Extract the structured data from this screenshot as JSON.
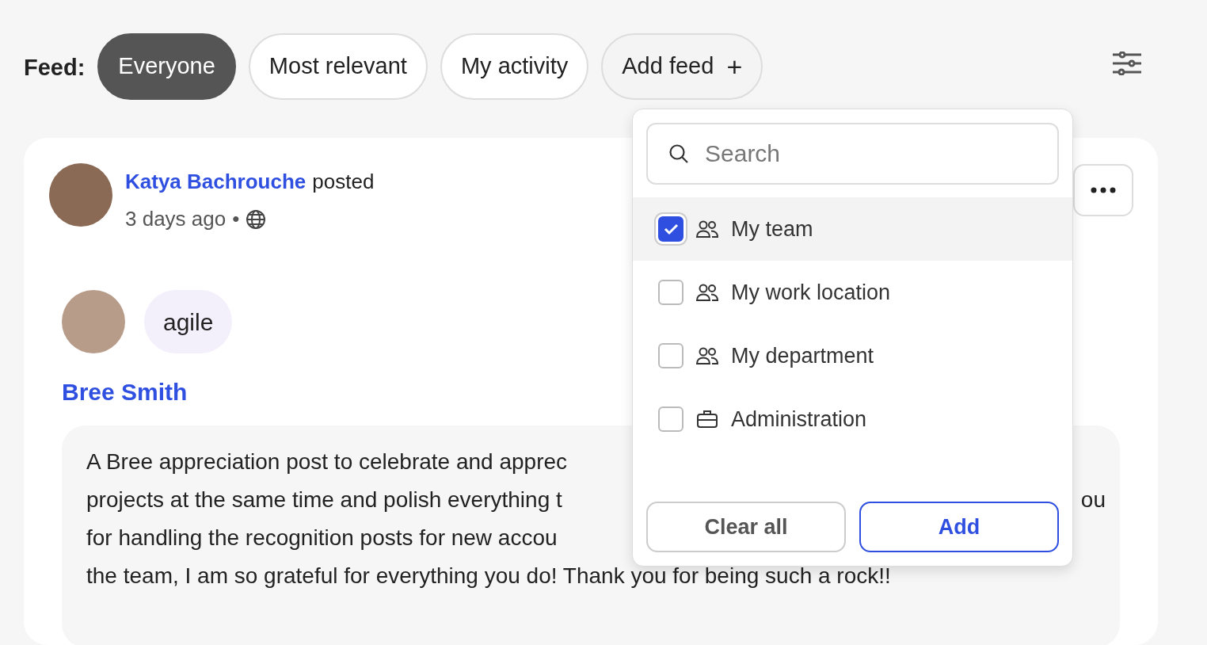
{
  "feed_bar": {
    "label": "Feed:",
    "tabs": [
      {
        "label": "Everyone",
        "selected": true
      },
      {
        "label": "Most relevant",
        "selected": false
      },
      {
        "label": "My activity",
        "selected": false
      }
    ],
    "add_button": "Add feed",
    "add_icon": "+"
  },
  "post": {
    "author": "Katya Bachrouche",
    "action": "posted",
    "time": "3 days ago",
    "separator": "•",
    "tag": "agile",
    "recipient": "Bree Smith",
    "body_lines": [
      {
        "left": "A Bree appreciation post to celebrate and apprec"
      },
      {
        "left": "projects at the same time and polish everything t",
        "right": "ou"
      },
      {
        "left": "for handling the recognition posts for new accou"
      },
      {
        "left": "the team, I am so grateful for everything you do! Thank you for being such a rock!!"
      }
    ]
  },
  "dropdown": {
    "search": {
      "placeholder": "Search"
    },
    "options": [
      {
        "label": "My team",
        "kind": "group",
        "checked": true,
        "highlighted": true
      },
      {
        "label": "My work location",
        "kind": "group",
        "checked": false,
        "highlighted": false
      },
      {
        "label": "My department",
        "kind": "group",
        "checked": false,
        "highlighted": false
      },
      {
        "label": "Administration",
        "kind": "department",
        "checked": false,
        "highlighted": false
      }
    ],
    "buttons": [
      {
        "label": "Clear all",
        "kind": "secondary"
      },
      {
        "label": "Add",
        "kind": "primary"
      }
    ]
  }
}
